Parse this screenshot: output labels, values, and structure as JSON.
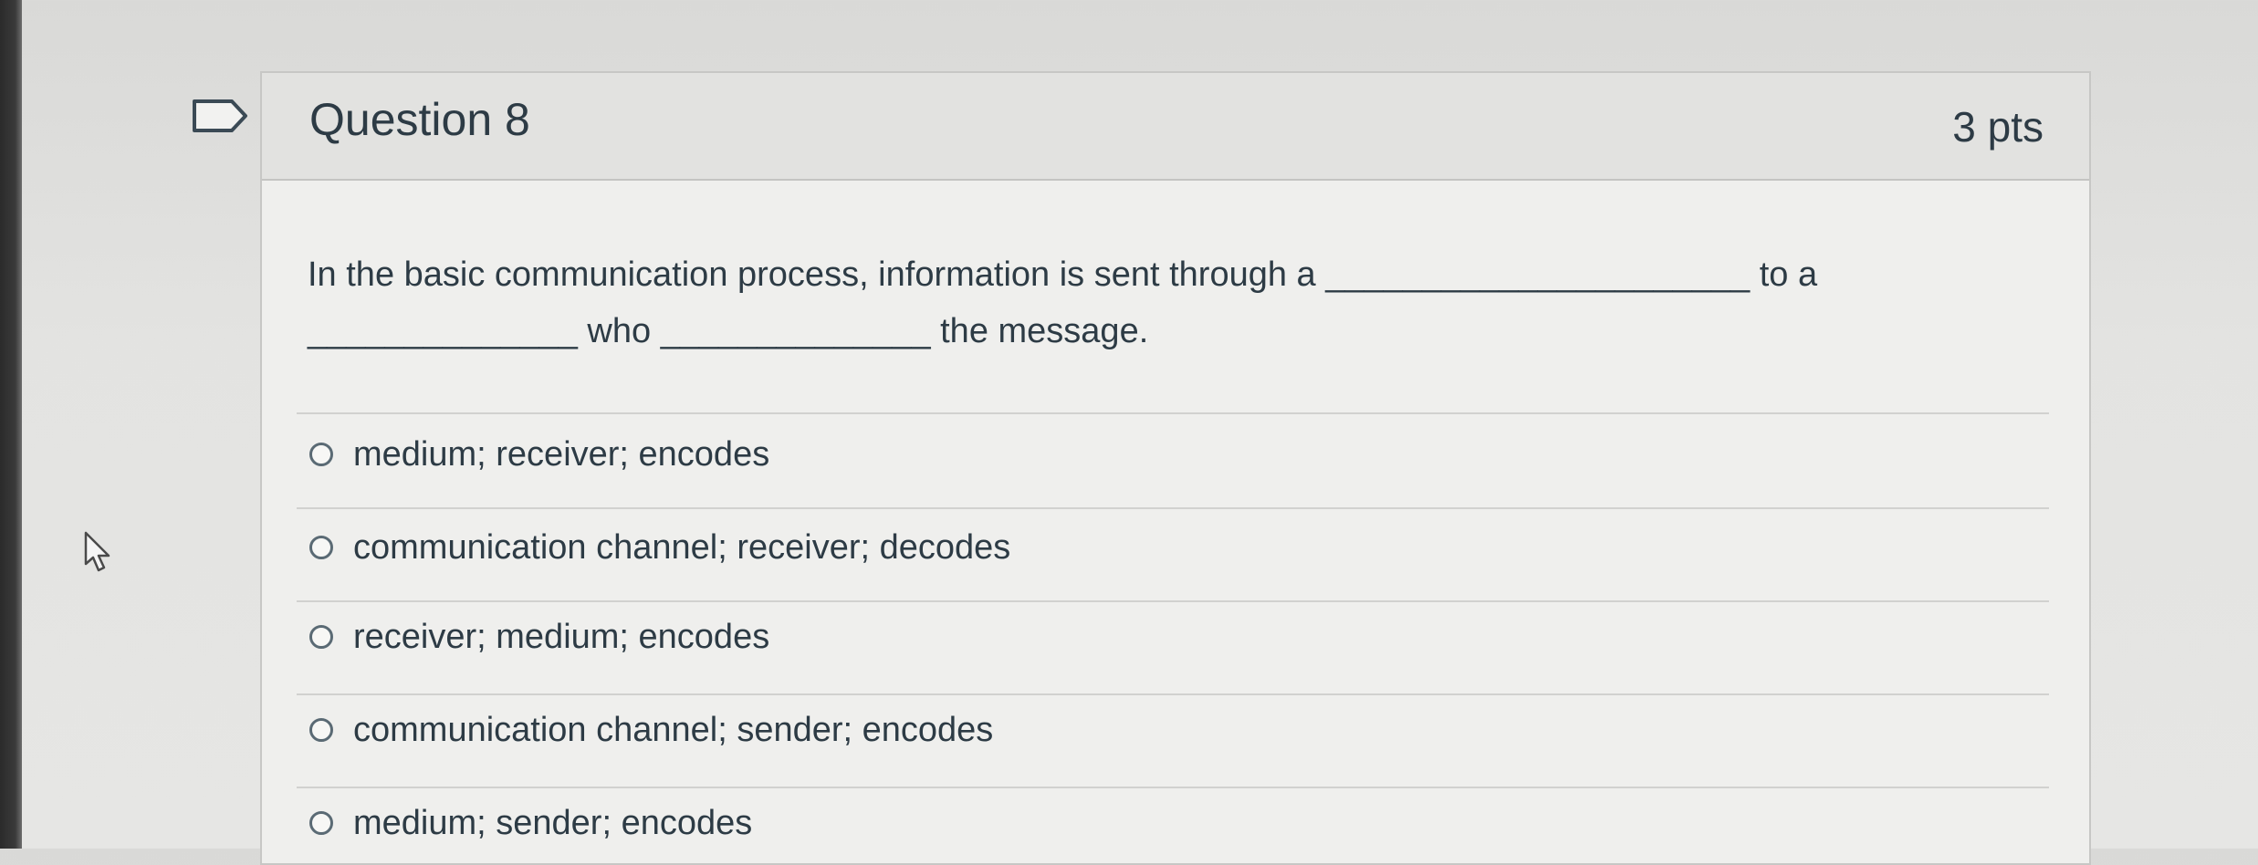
{
  "question": {
    "title": "Question 8",
    "points": "3 pts",
    "text_line1": "In the basic communication process,  information is sent through a ______________________ to a",
    "text_line2": "______________ who ______________ the message."
  },
  "answers": [
    {
      "label": "medium; receiver; encodes"
    },
    {
      "label": "communication channel; receiver; decodes"
    },
    {
      "label": "receiver; medium; encodes"
    },
    {
      "label": "communication channel; sender; encodes"
    },
    {
      "label": "medium; sender; encodes"
    }
  ],
  "icons": {
    "flag": "flag-question-icon",
    "cursor": "mouse-pointer-icon"
  },
  "colors": {
    "text": "#2d3b45",
    "header_bg": "#e2e2e0",
    "card_bg": "#efefed"
  }
}
